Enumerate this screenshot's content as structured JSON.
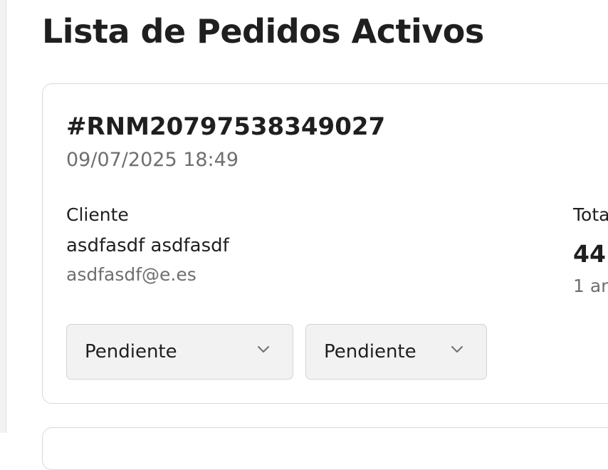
{
  "page": {
    "title": "Lista de Pedidos Activos"
  },
  "order": {
    "number": "#RNM20797538349027",
    "date": "09/07/2025 18:49",
    "customer": {
      "label": "Cliente",
      "name": "asdfasdf asdfasdf",
      "email": "asdfasdf@e.es"
    },
    "total": {
      "label": "Tota",
      "amount": "44.",
      "items": "1 ar"
    },
    "status_select": {
      "value": "Pendiente",
      "icon": "chevron-down-icon"
    },
    "payment_select": {
      "value": "Pendiente",
      "icon": "chevron-down-icon"
    }
  },
  "colors": {
    "text": "#1f1f1f",
    "muted": "#6f6f6f",
    "border": "#d9d9d9",
    "select_bg": "#f2f2f2"
  }
}
